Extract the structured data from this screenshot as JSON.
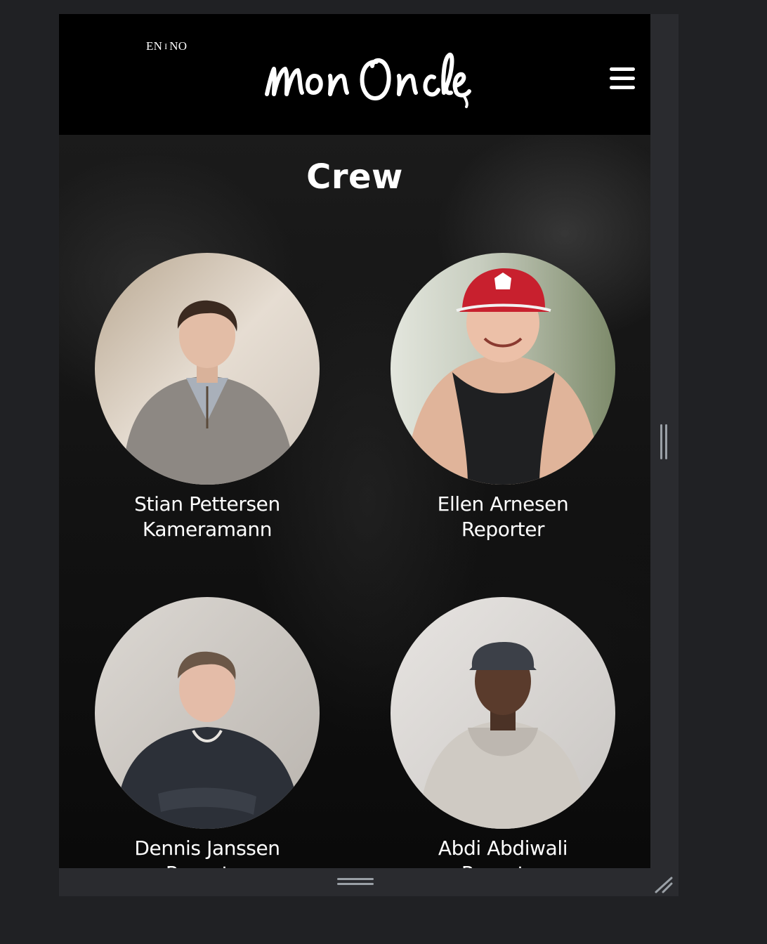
{
  "header": {
    "lang_en": "EN",
    "lang_sep": "I",
    "lang_no": "NO",
    "logo_text": "Mon Oncle",
    "menu_icon": "hamburger-menu-icon"
  },
  "page": {
    "title": "Crew"
  },
  "crew": [
    {
      "name": "Stian Pettersen",
      "role": "Kameramann"
    },
    {
      "name": "Ellen Arnesen",
      "role": "Reporter"
    },
    {
      "name": "Dennis Janssen",
      "role": "Reporter"
    },
    {
      "name": "Abdi Abdiwali",
      "role": "Reporter"
    }
  ],
  "colors": {
    "header_bg": "#000000",
    "text": "#ffffff",
    "frame": "#2a2b2f",
    "outer_bg": "#202124"
  }
}
